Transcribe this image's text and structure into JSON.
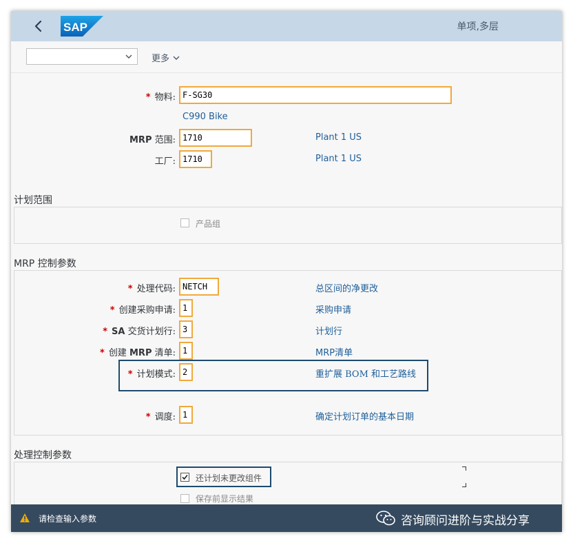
{
  "header": {
    "title": "单项,多层",
    "logo_text": "SAP"
  },
  "toolbar": {
    "variant_value": "",
    "more_label": "更多"
  },
  "material": {
    "label": "物料:",
    "value": "F-SG30",
    "description": "C990 Bike"
  },
  "mrp_area": {
    "label_bold": "MRP",
    "label_rest": " 范围:",
    "value": "1710",
    "description": "Plant 1 US"
  },
  "plant": {
    "label": "工厂:",
    "value": "1710",
    "description": "Plant 1 US"
  },
  "planning_scope": {
    "title": "计划范围",
    "product_group_label": "产品组",
    "product_group_checked": false
  },
  "mrp_control": {
    "title": "MRP 控制参数",
    "processing_key": {
      "label": "处理代码:",
      "value": "NETCH",
      "description": "总区间的净更改"
    },
    "create_pr": {
      "label": "创建采购申请:",
      "value": "1",
      "description": "采购申请"
    },
    "sa_schedule": {
      "label_bold": "SA",
      "label_rest": " 交货计划行:",
      "value": "3",
      "description": "计划行"
    },
    "create_mrp_list": {
      "label_pre": "创建 ",
      "label_bold": "MRP",
      "label_rest": " 清单:",
      "value": "1",
      "description": "MRP清单"
    },
    "planning_mode": {
      "label": "计划模式:",
      "value": "2",
      "description": "重扩展 BOM 和工艺路线"
    },
    "scheduling": {
      "label": "调度:",
      "value": "1",
      "description": "确定计划订单的基本日期"
    }
  },
  "process_control": {
    "title": "处理控制参数",
    "also_plan_unchanged": {
      "label": "还计划未更改组件",
      "checked": true
    },
    "save_results": {
      "label": "保存前显示结果",
      "checked": false
    }
  },
  "footer": {
    "message": "请检查输入参数",
    "brand": "咨询顾问进阶与实战分享"
  },
  "colors": {
    "header_bg": "#c6d7e7",
    "input_border": "#f0a93b",
    "link": "#1f5f9a",
    "required": "#cc0000",
    "highlight": "#1c4a6e",
    "footer_bg": "#354a5f",
    "warning": "#f0ab00"
  },
  "icons": [
    "back-icon",
    "chevron-down-icon",
    "warning-icon",
    "wechat-icon"
  ]
}
